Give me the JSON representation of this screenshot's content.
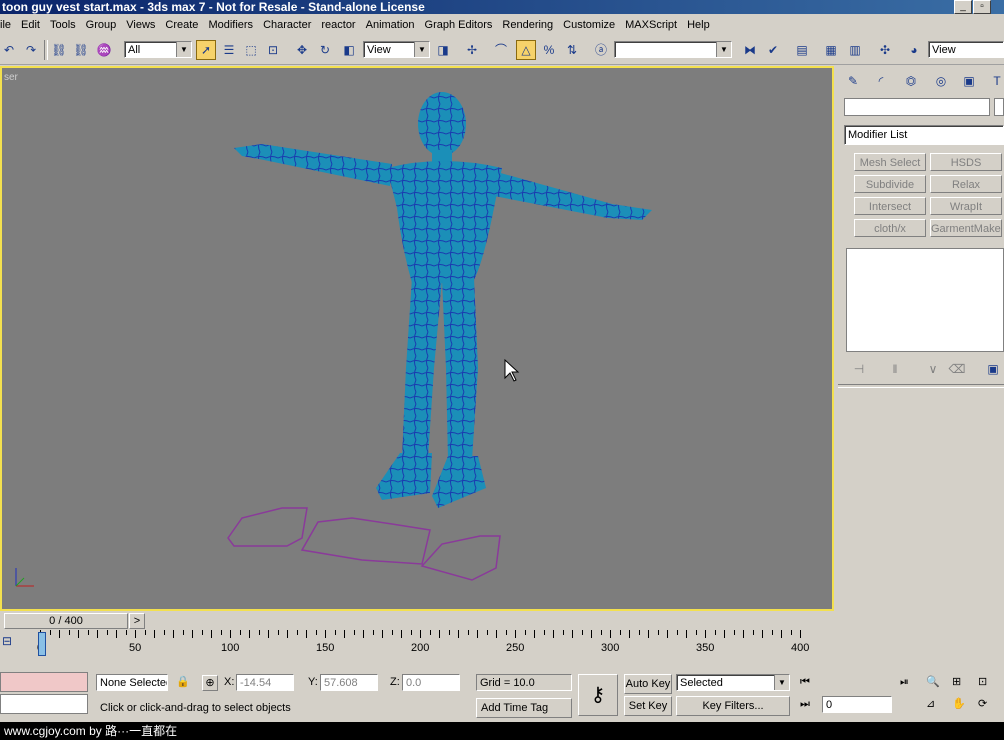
{
  "window": {
    "title": "toon guy vest start.max - 3ds max 7 - Not for Resale - Stand-alone License"
  },
  "menu": {
    "items": [
      "ile",
      "Edit",
      "Tools",
      "Group",
      "Views",
      "Create",
      "Modifiers",
      "Character",
      "reactor",
      "Animation",
      "Graph Editors",
      "Rendering",
      "Customize",
      "MAXScript",
      "Help"
    ]
  },
  "toolbar": {
    "selection_filter": "All",
    "reference_coord": "View",
    "named_selection": "",
    "view_right": "View"
  },
  "viewport": {
    "label": "ser"
  },
  "command_panel": {
    "modifier_list": "Modifier List",
    "buttons": [
      "Mesh Select",
      "HSDS",
      "Subdivide",
      "Relax",
      "Intersect",
      "WrapIt",
      "cloth/x",
      "GarmentMaker"
    ],
    "name_field": ""
  },
  "timeline": {
    "frame_display": "0 / 400",
    "ticks": [
      "0",
      "50",
      "100",
      "150",
      "200",
      "250",
      "300",
      "350",
      "400"
    ]
  },
  "status": {
    "selection": "None Selected",
    "x_label": "X:",
    "x_value": "-14.54",
    "y_label": "Y:",
    "y_value": "57.608",
    "z_label": "Z:",
    "z_value": "0.0",
    "grid": "Grid = 10.0",
    "prompt": "Click or click-and-drag to select objects",
    "add_time_tag": "Add Time Tag",
    "auto_key": "Auto Key",
    "set_key": "Set Key",
    "key_mode": "Selected",
    "key_filters": "Key Filters...",
    "frame": "0"
  },
  "footer": {
    "text": "www.cgjoy.com by 路···一直都在"
  },
  "colors": {
    "viewport_bg": "#7d7d7d",
    "active_border": "#f3e04e",
    "mesh": "#1b8fb8",
    "wire": "#1a3ab0",
    "pattern": "#8a3a9a"
  }
}
